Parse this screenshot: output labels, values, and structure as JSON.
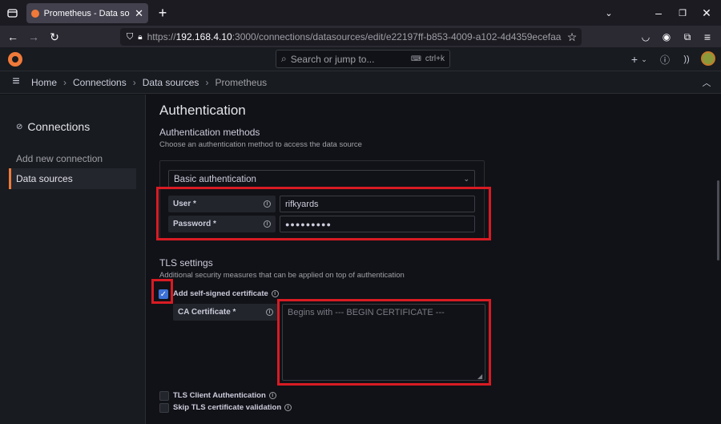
{
  "browser": {
    "tab_title": "Prometheus - Data sources - Co",
    "url_prefix": "https://",
    "url_host": "192.168.4.10",
    "url_rest": ":3000/connections/datasources/edit/e22197ff-b853-4009-a102-4d4359ecefaa"
  },
  "topbar": {
    "search_placeholder": "Search or jump to...",
    "search_shortcut": "ctrl+k",
    "add_label": "+"
  },
  "breadcrumb": {
    "items": [
      "Home",
      "Connections",
      "Data sources",
      "Prometheus"
    ]
  },
  "sidebar": {
    "title": "Connections",
    "items": [
      {
        "label": "Add new connection"
      },
      {
        "label": "Data sources"
      }
    ]
  },
  "auth": {
    "heading": "Authentication",
    "methods_title": "Authentication methods",
    "methods_sub": "Choose an authentication method to access the data source",
    "method_value": "Basic authentication",
    "user_label": "User *",
    "user_value": "rifkyards",
    "password_label": "Password *",
    "password_value": "●●●●●●●●●"
  },
  "tls": {
    "title": "TLS settings",
    "sub": "Additional security measures that can be applied on top of authentication",
    "self_signed_label": "Add self-signed certificate",
    "ca_label": "CA Certificate *",
    "ca_placeholder": "Begins with --- BEGIN CERTIFICATE ---",
    "client_auth_label": "TLS Client Authentication",
    "skip_verify_label": "Skip TLS certificate validation"
  },
  "colors": {
    "accent": "#f07a3a",
    "checkbox": "#3d71d9",
    "highlight": "#d81b23"
  }
}
